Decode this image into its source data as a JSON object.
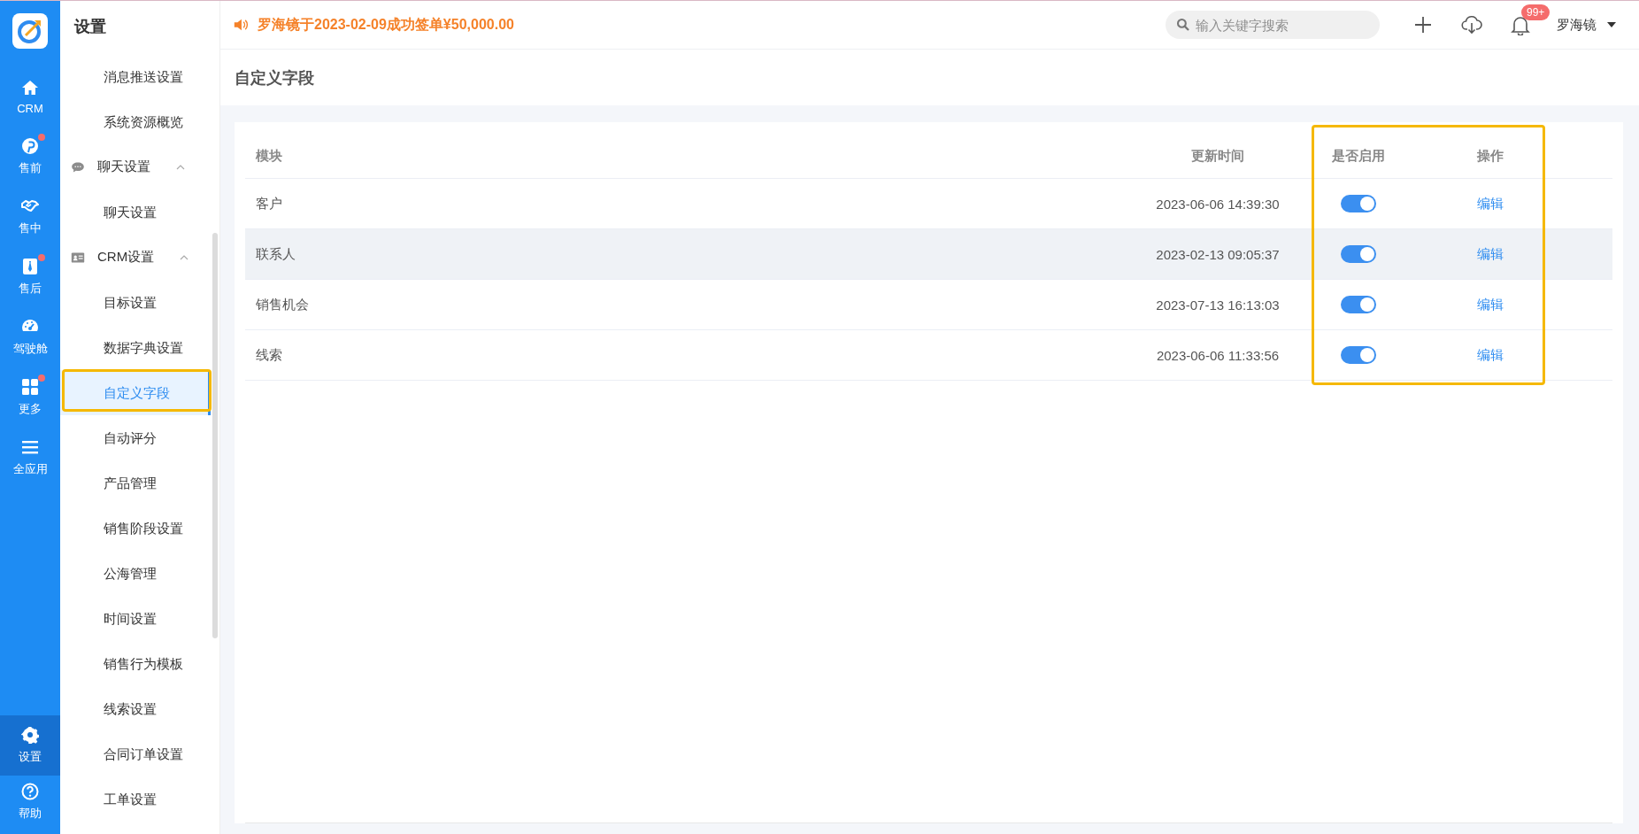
{
  "rail": {
    "items": [
      {
        "label": "CRM",
        "badge": false,
        "selected": false
      },
      {
        "label": "售前",
        "badge": true,
        "selected": false
      },
      {
        "label": "售中",
        "badge": false,
        "selected": false
      },
      {
        "label": "售后",
        "badge": true,
        "selected": false
      },
      {
        "label": "驾驶舱",
        "badge": false,
        "selected": false
      },
      {
        "label": "更多",
        "badge": true,
        "selected": false
      },
      {
        "label": "全应用",
        "badge": false,
        "selected": false
      }
    ],
    "bottom": [
      {
        "label": "设置",
        "badge": false,
        "selected": true
      },
      {
        "label": "帮助",
        "badge": false,
        "selected": false
      }
    ]
  },
  "sidebar": {
    "title": "设置",
    "items": [
      {
        "label": "消息推送设置",
        "selected": false,
        "highlighted": false
      },
      {
        "label": "系统资源概览",
        "selected": false,
        "highlighted": false
      },
      {
        "label": "聊天设置",
        "expanded": true,
        "children": [
          {
            "label": "聊天设置",
            "selected": false,
            "highlighted": false
          }
        ]
      },
      {
        "label": "CRM设置",
        "expanded": true,
        "children": [
          {
            "label": "目标设置",
            "selected": false,
            "highlighted": false
          },
          {
            "label": "数据字典设置",
            "selected": false,
            "highlighted": false
          },
          {
            "label": "自定义字段",
            "selected": true,
            "highlighted": true
          },
          {
            "label": "自动评分",
            "selected": false,
            "highlighted": false
          },
          {
            "label": "产品管理",
            "selected": false,
            "highlighted": false
          },
          {
            "label": "销售阶段设置",
            "selected": false,
            "highlighted": false
          },
          {
            "label": "公海管理",
            "selected": false,
            "highlighted": false
          },
          {
            "label": "时间设置",
            "selected": false,
            "highlighted": false
          },
          {
            "label": "销售行为模板",
            "selected": false,
            "highlighted": false
          },
          {
            "label": "线索设置",
            "selected": false,
            "highlighted": false
          },
          {
            "label": "合同订单设置",
            "selected": false,
            "highlighted": false
          },
          {
            "label": "工单设置",
            "selected": false,
            "highlighted": false
          }
        ]
      }
    ]
  },
  "topbar": {
    "announcement": "罗海镜于2023-02-09成功签单¥50,000.00",
    "search": {
      "placeholder": "输入关键字搜索"
    },
    "notifications": "99+",
    "user": "罗海镜"
  },
  "page": {
    "title": "自定义字段"
  },
  "table": {
    "columns": [
      "模块",
      "更新时间",
      "是否启用",
      "操作"
    ],
    "highlight_frame": true,
    "rows": [
      {
        "module": "客户",
        "updated": "2023-06-06 14:39:30",
        "enabled": true,
        "action": "编辑",
        "hovered": false
      },
      {
        "module": "联系人",
        "updated": "2023-02-13 09:05:37",
        "enabled": true,
        "action": "编辑",
        "hovered": true
      },
      {
        "module": "销售机会",
        "updated": "2023-07-13 16:13:03",
        "enabled": true,
        "action": "编辑",
        "hovered": false
      },
      {
        "module": "线索",
        "updated": "2023-06-06 11:33:56",
        "enabled": true,
        "action": "编辑",
        "hovered": false
      }
    ]
  }
}
